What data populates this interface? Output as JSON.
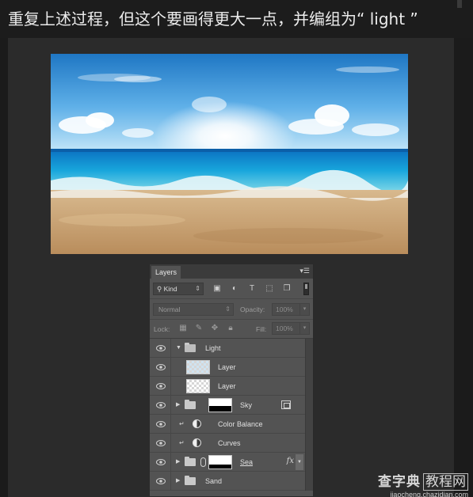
{
  "heading": "重复上述过程，但这个要画得更大一点，并编组为“ light ”",
  "layers_panel": {
    "tab_label": "Layers",
    "filter_kind": "Kind",
    "blend_mode": "Normal",
    "opacity_label": "Opacity:",
    "opacity_value": "100%",
    "lock_label": "Lock:",
    "fill_label": "Fill:",
    "fill_value": "100%",
    "layers": [
      {
        "name": "Light",
        "type": "group",
        "expanded": true
      },
      {
        "name": "Layer",
        "type": "pixel",
        "thumbnail": "light-blue-checker"
      },
      {
        "name": "Layer",
        "type": "pixel",
        "thumbnail": "checker"
      },
      {
        "name": "Sky",
        "type": "group-with-mask"
      },
      {
        "name": "Color Balance",
        "type": "adjustment",
        "clipped": true
      },
      {
        "name": "Curves",
        "type": "adjustment",
        "clipped": true
      },
      {
        "name": "Sea",
        "type": "group-with-mask",
        "has_fx": true
      },
      {
        "name": "Sand",
        "type": "group"
      }
    ]
  },
  "watermark": {
    "main": "查字典",
    "sub": "教程网",
    "url": "jiaocheng.chazidian.com"
  },
  "colors": {
    "page_bg": "#1b1b1b",
    "stage_bg": "#2b2b2b",
    "panel_bg": "#535353"
  }
}
